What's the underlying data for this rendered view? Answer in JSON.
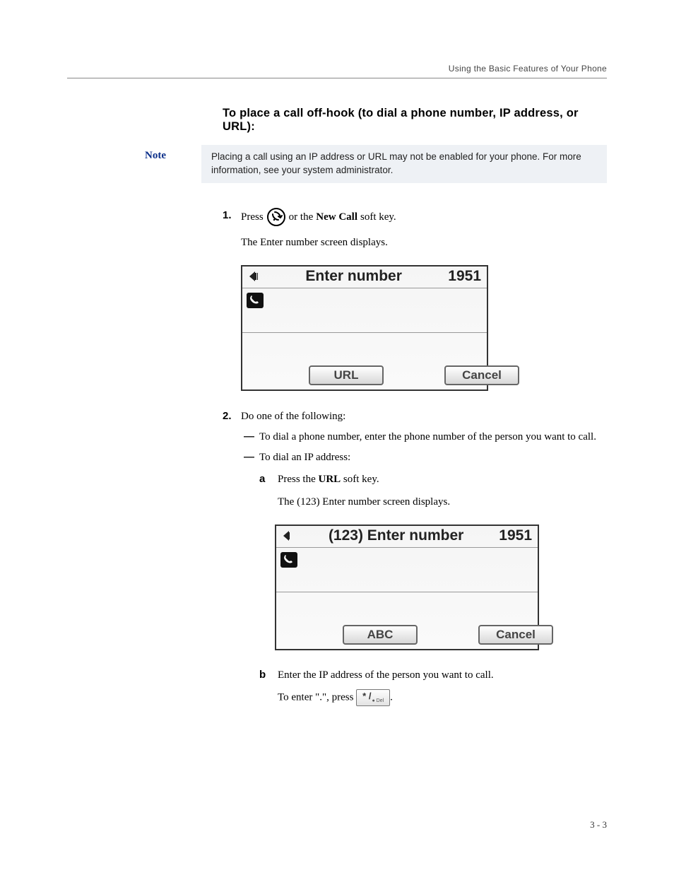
{
  "running_head": "Using the Basic Features of Your Phone",
  "heading": "To place a call off-hook (to dial a phone number, IP address, or URL):",
  "note": {
    "label": "Note",
    "text": "Placing a call using an IP address or URL may not be enabled for your phone. For more information, see your system administrator."
  },
  "step1": {
    "num": "1.",
    "press": "Press",
    "or_the": "or the",
    "newcall": "New Call",
    "softkey": "soft key.",
    "desc": "The Enter number screen displays.",
    "screen": {
      "title": "Enter number",
      "ext": "1951",
      "sk_left": "URL",
      "sk_right": "Cancel"
    }
  },
  "step2": {
    "num": "2.",
    "intro": "Do one of the following:",
    "dash_a": "To dial a phone number, enter the phone number of the person you want to call.",
    "dash_b": "To dial an IP address:",
    "a": {
      "letter": "a",
      "press_the": "Press the",
      "url": "URL",
      "softkey": "soft key.",
      "desc": "The (123) Enter number screen displays.",
      "screen": {
        "title": "(123) Enter number",
        "ext": "1951",
        "sk_left": "ABC",
        "sk_right": "Cancel"
      }
    },
    "b": {
      "letter": "b",
      "line1": "Enter the IP address of the person you want to call.",
      "enter_prefix": "To enter \".\", press",
      "key_main": "* /",
      "key_sub": "●\nDel",
      "period": "."
    }
  },
  "pagenum": "3 - 3"
}
